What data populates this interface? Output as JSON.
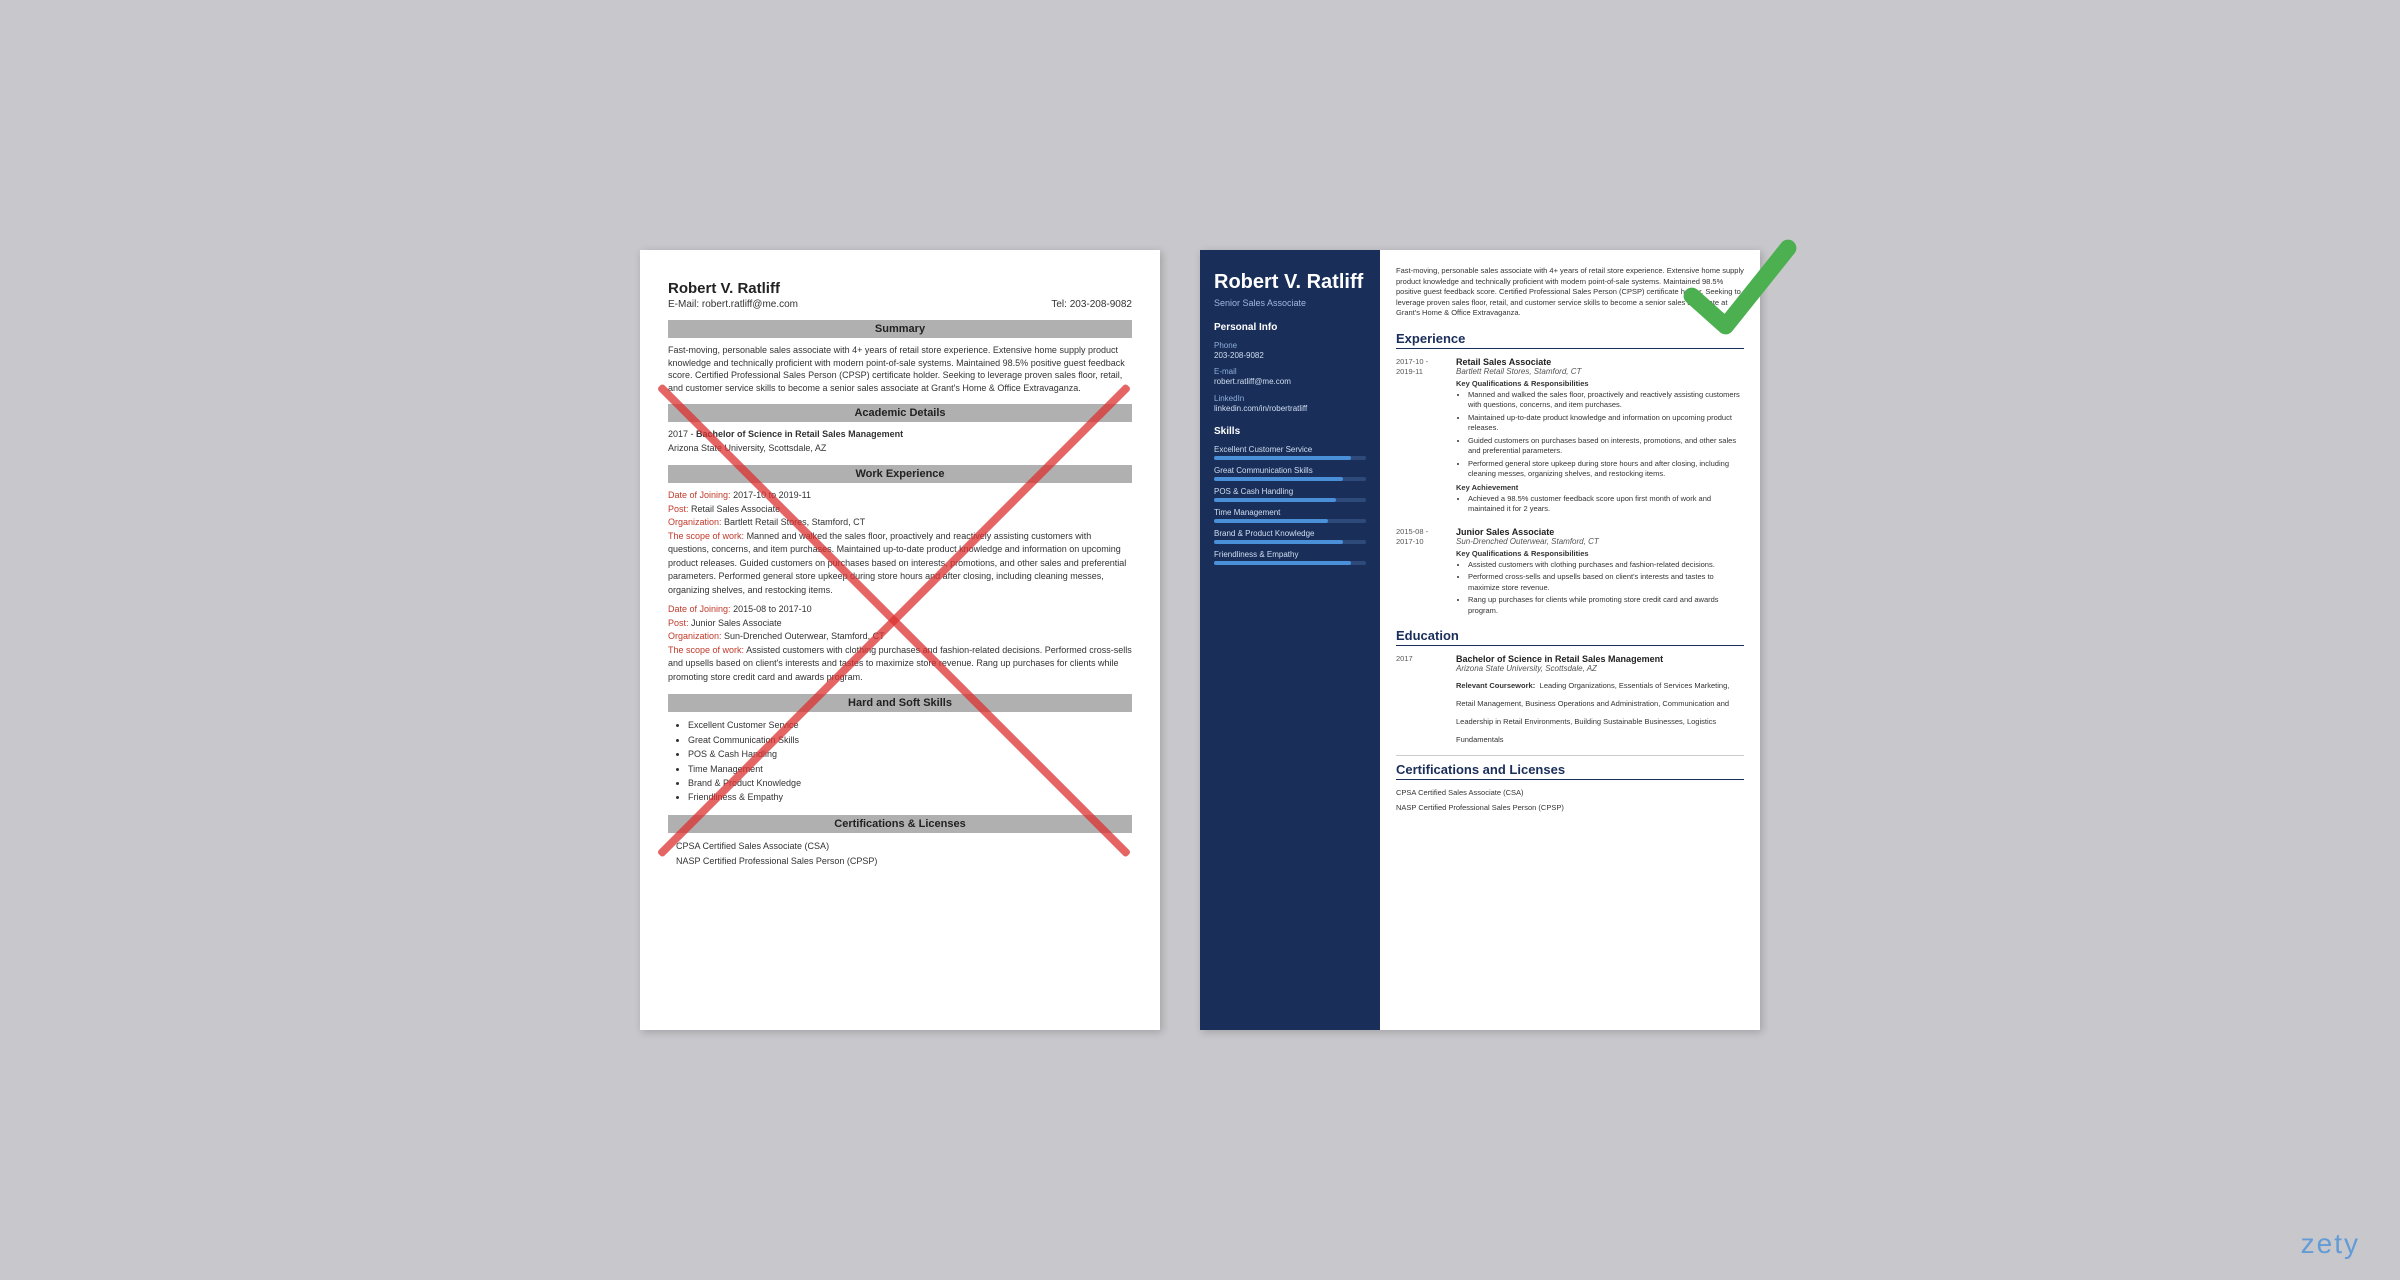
{
  "background_color": "#c8c8cc",
  "bad_resume": {
    "name": "Robert V. Ratliff",
    "email_label": "E-Mail:",
    "email": "robert.ratliff@me.com",
    "tel_label": "Tel:",
    "phone": "203-208-9082",
    "sections": {
      "summary": {
        "header": "Summary",
        "text": "Fast-moving, personable sales associate with 4+ years of retail store experience. Extensive home supply product knowledge and technically proficient with modern point-of-sale systems. Maintained 98.5% positive guest feedback score. Certified Professional Sales Person (CPSP) certificate holder. Seeking to leverage proven sales floor, retail, and customer service skills to become a senior sales associate at Grant's Home & Office Extravaganza."
      },
      "academic": {
        "header": "Academic Details",
        "entry": {
          "year": "2017 -",
          "degree": "Bachelor of Science in Retail Sales Management",
          "school": "Arizona State University, Scottsdale, AZ"
        }
      },
      "work": {
        "header": "Work Experience",
        "entries": [
          {
            "date_label": "Date of Joining:",
            "date": "2017-10 to 2019-11",
            "post_label": "Post:",
            "post": "Retail Sales Associate",
            "org_label": "Organization:",
            "org": "Bartlett Retail Stores, Stamford, CT",
            "scope_label": "The scope of work:",
            "scope": "Manned and walked the sales floor, proactively and reactively assisting customers with questions, concerns, and item purchases. Maintained up-to-date product knowledge and information on upcoming product releases. Guided customers on purchases based on interests, promotions, and other sales and preferential parameters. Performed general store upkeep during store hours and after closing, including cleaning messes, organizing shelves, and restocking items."
          },
          {
            "date_label": "Date of Joining:",
            "date": "2015-08 to 2017-10",
            "post_label": "Post:",
            "post": "Junior Sales Associate",
            "org_label": "Organization:",
            "org": "Sun-Drenched Outerwear, Stamford, CT",
            "scope_label": "The scope of work:",
            "scope": "Assisted customers with clothing purchases and fashion-related decisions. Performed cross-sells and upsells based on client's interests and tastes to maximize store revenue. Rang up purchases for clients while promoting store credit card and awards program."
          }
        ]
      },
      "skills": {
        "header": "Hard and Soft Skills",
        "items": [
          "Excellent Customer Service",
          "Great Communication Skills",
          "POS & Cash Handling",
          "Time Management",
          "Brand & Product Knowledge",
          "Friendliness & Empathy"
        ]
      },
      "certs": {
        "header": "Certifications & Licenses",
        "items": [
          "CPSA Certified Sales Associate (CSA)",
          "NASP Certified Professional Sales Person (CPSP)"
        ]
      }
    }
  },
  "good_resume": {
    "name": "Robert V. Ratliff",
    "title": "Senior Sales Associate",
    "summary": "Fast-moving, personable sales associate with 4+ years of retail store experience. Extensive home supply product knowledge and technically proficient with modern point-of-sale systems. Maintained 98.5% positive guest feedback score. Certified Professional Sales Person (CPSP) certificate holder. Seeking to leverage proven sales floor, retail, and customer service skills to become a senior sales associate at Grant's Home & Office Extravaganza.",
    "sidebar": {
      "personal_info": {
        "label": "Personal Info",
        "phone_label": "Phone",
        "phone": "203-208-9082",
        "email_label": "E-mail",
        "email": "robert.ratliff@me.com",
        "linkedin_label": "LinkedIn",
        "linkedin": "linkedin.com/in/robertratliff"
      },
      "skills": {
        "label": "Skills",
        "items": [
          {
            "name": "Excellent Customer Service",
            "pct": 90
          },
          {
            "name": "Great Communication Skills",
            "pct": 85
          },
          {
            "name": "POS & Cash Handling",
            "pct": 80
          },
          {
            "name": "Time Management",
            "pct": 75
          },
          {
            "name": "Brand & Product Knowledge",
            "pct": 85
          },
          {
            "name": "Friendliness & Empathy",
            "pct": 90
          }
        ]
      }
    },
    "experience": {
      "section_title": "Experience",
      "entries": [
        {
          "date": "2017-10 -\n2019-11",
          "title": "Retail Sales Associate",
          "org": "Bartlett Retail Stores, Stamford, CT",
          "qualifications_label": "Key Qualifications & Responsibilities",
          "bullets": [
            "Manned and walked the sales floor, proactively and reactively assisting customers with questions, concerns, and item purchases.",
            "Maintained up-to-date product knowledge and information on upcoming product releases.",
            "Guided customers on purchases based on interests, promotions, and other sales and preferential parameters.",
            "Performed general store upkeep during store hours and after closing, including cleaning messes, organizing shelves, and restocking items."
          ],
          "achievement_label": "Key Achievement",
          "achievement": "Achieved a 98.5% customer feedback score upon first month of work and maintained it for 2 years."
        },
        {
          "date": "2015-08 -\n2017-10",
          "title": "Junior Sales Associate",
          "org": "Sun-Drenched Outerwear, Stamford, CT",
          "qualifications_label": "Key Qualifications & Responsibilities",
          "bullets": [
            "Assisted customers with clothing purchases and fashion-related decisions.",
            "Performed cross-sells and upsells based on client's interests and tastes to maximize store revenue.",
            "Rang up purchases for clients while promoting store credit card and awards program."
          ]
        }
      ]
    },
    "education": {
      "section_title": "Education",
      "entries": [
        {
          "date": "2017",
          "degree": "Bachelor of Science in Retail Sales Management",
          "school": "Arizona State University, Scottsdale, AZ",
          "coursework_label": "Relevant Coursework:",
          "coursework": "Leading Organizations, Essentials of Services Marketing, Retail Management, Business Operations and Administration, Communication and Leadership in Retail Environments, Building Sustainable Businesses, Logistics Fundamentals"
        }
      ]
    },
    "certifications": {
      "section_title": "Certifications and Licenses",
      "items": [
        "CPSA Certified Sales Associate (CSA)",
        "NASP Certified Professional Sales Person (CPSP)"
      ]
    }
  },
  "watermark": "zety"
}
